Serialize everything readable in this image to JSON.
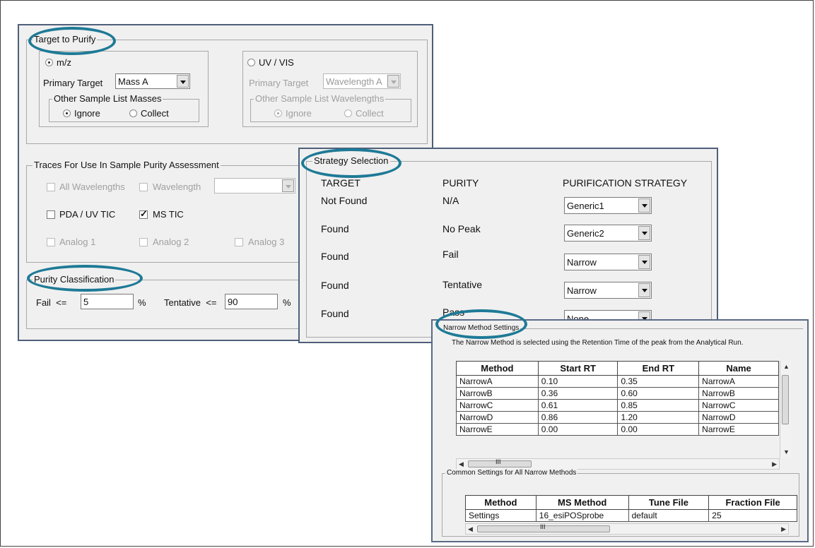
{
  "target_panel": {
    "group_title": "Target to Purify",
    "mz": {
      "label": "m/z",
      "primary_target_label": "Primary Target",
      "primary_target_value": "Mass A",
      "other_group_title": "Other Sample List Masses",
      "ignore_label": "Ignore",
      "collect_label": "Collect"
    },
    "uv": {
      "label": "UV / VIS",
      "primary_target_label": "Primary Target",
      "primary_target_value": "Wavelength A",
      "other_group_title": "Other Sample List Wavelengths",
      "ignore_label": "Ignore",
      "collect_label": "Collect"
    }
  },
  "traces_panel": {
    "group_title": "Traces For Use In Sample Purity Assessment",
    "all_wavelengths": "All Wavelengths",
    "wavelength": "Wavelength",
    "pda_uv_tic": "PDA / UV TIC",
    "ms_tic": "MS TIC",
    "analog1": "Analog 1",
    "analog2": "Analog 2",
    "analog3": "Analog 3"
  },
  "purity_panel": {
    "group_title": "Purity Classification",
    "fail_label": "Fail  <=",
    "fail_value": "5",
    "fail_unit": "%",
    "tentative_label": "Tentative  <=",
    "tentative_value": "90",
    "tentative_unit": "%"
  },
  "strategy_panel": {
    "group_title": "Strategy Selection",
    "headers": {
      "target": "TARGET",
      "purity": "PURITY",
      "strategy": "PURIFICATION STRATEGY"
    },
    "rows": [
      {
        "target": "Not Found",
        "purity": "N/A",
        "strategy": "Generic1"
      },
      {
        "target": "Found",
        "purity": "No Peak",
        "strategy": "Generic2"
      },
      {
        "target": "Found",
        "purity": "Fail",
        "strategy": "Narrow"
      },
      {
        "target": "Found",
        "purity": "Tentative",
        "strategy": "Narrow"
      },
      {
        "target": "Found",
        "purity": "Pass",
        "strategy": "None"
      }
    ]
  },
  "narrow_panel": {
    "group_title": "Narrow Method Settings",
    "description": "The Narrow Method is selected using the Retention Time of the peak from the Analytical Run.",
    "columns": [
      "Method",
      "Start RT",
      "End RT",
      "Name"
    ],
    "rows": [
      [
        "NarrowA",
        "0.10",
        "0.35",
        "NarrowA"
      ],
      [
        "NarrowB",
        "0.36",
        "0.60",
        "NarrowB"
      ],
      [
        "NarrowC",
        "0.61",
        "0.85",
        "NarrowC"
      ],
      [
        "NarrowD",
        "0.86",
        "1.20",
        "NarrowD"
      ],
      [
        "NarrowE",
        "0.00",
        "0.00",
        "NarrowE"
      ]
    ],
    "scroll_glyph": "III",
    "common_group_title": "Common Settings for All Narrow Methods",
    "common_columns": [
      "Method",
      "MS Method",
      "Tune File",
      "Fraction File"
    ],
    "common_rows": [
      [
        "Settings",
        "16_esiPOSprobe",
        "default",
        "25"
      ]
    ]
  },
  "colors": {
    "highlight": "#1e7a96",
    "window_border": "#4f5f7a",
    "panel_bg": "#f0f0f0"
  }
}
